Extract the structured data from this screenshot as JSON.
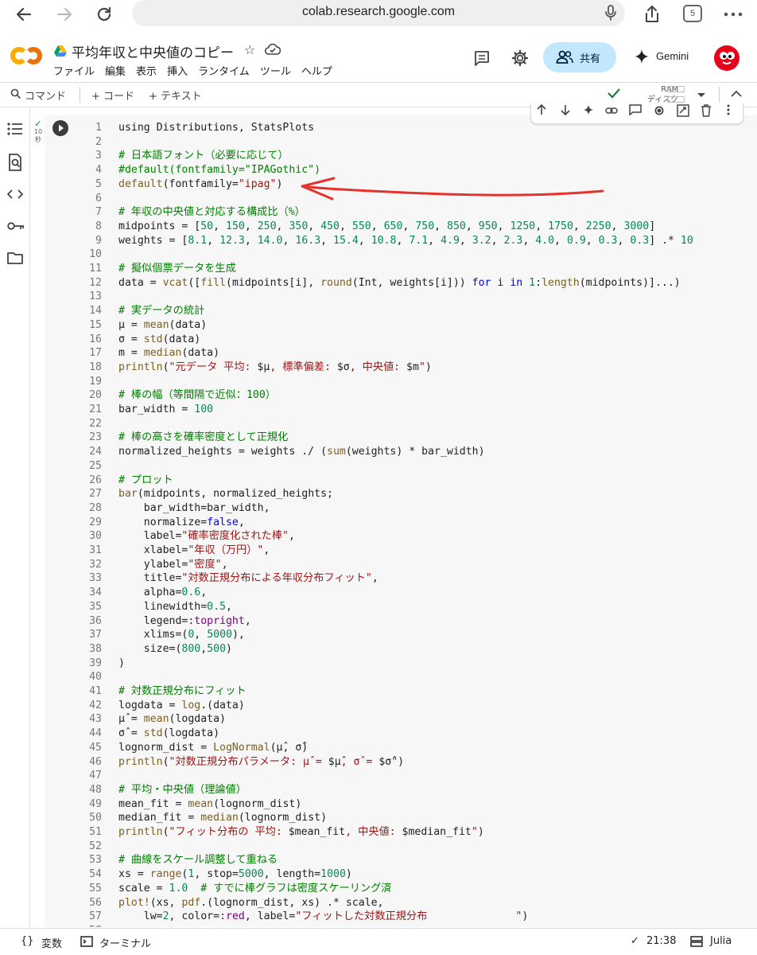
{
  "browser": {
    "url": "colab.research.google.com",
    "tab_count": "5"
  },
  "header": {
    "notebook_title": "平均年収と中央値のコピー",
    "share_label": "共有",
    "gemini_label": "Gemini",
    "menu": [
      "ファイル",
      "編集",
      "表示",
      "挿入",
      "ランタイム",
      "ツール",
      "ヘルプ"
    ]
  },
  "toolbar": {
    "command_label": "コマンド",
    "add_code_label": "+ コード",
    "add_text_label": "+ テキスト",
    "ram_label": "RAM",
    "disk_label": "ディスク"
  },
  "cell": {
    "exec_time": "10",
    "exec_unit": "秒",
    "lines": [
      {
        "n": "1",
        "html": "using Distributions, StatsPlots"
      },
      {
        "n": "2",
        "html": ""
      },
      {
        "n": "3",
        "html": "<span class='c'># 日本語フォント（必要に応じて）</span>"
      },
      {
        "n": "4",
        "html": "<span class='c'>#default(fontfamily=\"IPAGothic\")</span>"
      },
      {
        "n": "5",
        "html": "<span class='f'>default</span>(fontfamily=<span class='s'>\"ipag\"</span>)"
      },
      {
        "n": "6",
        "html": ""
      },
      {
        "n": "7",
        "html": "<span class='c'># 年収の中央値と対応する構成比（%）</span>"
      },
      {
        "n": "8",
        "html": "midpoints = [<span class='n'>50</span>, <span class='n'>150</span>, <span class='n'>250</span>, <span class='n'>350</span>, <span class='n'>450</span>, <span class='n'>550</span>, <span class='n'>650</span>, <span class='n'>750</span>, <span class='n'>850</span>, <span class='n'>950</span>, <span class='n'>1250</span>, <span class='n'>1750</span>, <span class='n'>2250</span>, <span class='n'>3000</span>]"
      },
      {
        "n": "9",
        "html": "weights = [<span class='n'>8.1</span>, <span class='n'>12.3</span>, <span class='n'>14.0</span>, <span class='n'>16.3</span>, <span class='n'>15.4</span>, <span class='n'>10.8</span>, <span class='n'>7.1</span>, <span class='n'>4.9</span>, <span class='n'>3.2</span>, <span class='n'>2.3</span>, <span class='n'>4.0</span>, <span class='n'>0.9</span>, <span class='n'>0.3</span>, <span class='n'>0.3</span>] .* <span class='n'>10</span>"
      },
      {
        "n": "10",
        "html": ""
      },
      {
        "n": "11",
        "html": "<span class='c'># 擬似個票データを生成</span>"
      },
      {
        "n": "12",
        "html": "data = <span class='f'>vcat</span>([<span class='f'>fill</span>(midpoints[i], <span class='f'>round</span>(Int, weights[i])) <span class='k'>for</span> i <span class='k'>in</span> <span class='n'>1</span>:<span class='f'>length</span>(midpoints)]...)"
      },
      {
        "n": "13",
        "html": ""
      },
      {
        "n": "14",
        "html": "<span class='c'># 実データの統計</span>"
      },
      {
        "n": "15",
        "html": "μ = <span class='f'>mean</span>(data)"
      },
      {
        "n": "16",
        "html": "σ = <span class='f'>std</span>(data)"
      },
      {
        "n": "17",
        "html": "m = <span class='f'>median</span>(data)"
      },
      {
        "n": "18",
        "html": "<span class='f'>println</span>(<span class='s'>\"元データ 平均: </span>$μ<span class='s'>, 標準偏差: </span>$σ<span class='s'>, 中央値: </span>$m<span class='s'>\"</span>)"
      },
      {
        "n": "19",
        "html": ""
      },
      {
        "n": "20",
        "html": "<span class='c'># 棒の幅（等間隔で近似：100）</span>"
      },
      {
        "n": "21",
        "html": "bar_width = <span class='n'>100</span>"
      },
      {
        "n": "22",
        "html": ""
      },
      {
        "n": "23",
        "html": "<span class='c'># 棒の高さを確率密度として正規化</span>"
      },
      {
        "n": "24",
        "html": "normalized_heights = weights ./ (<span class='f'>sum</span>(weights) * bar_width)"
      },
      {
        "n": "25",
        "html": ""
      },
      {
        "n": "26",
        "html": "<span class='c'># プロット</span>"
      },
      {
        "n": "27",
        "html": "<span class='f'>bar</span>(midpoints, normalized_heights;"
      },
      {
        "n": "28",
        "html": "    bar_width=bar_width,"
      },
      {
        "n": "29",
        "html": "    normalize=<span class='k'>false</span>,"
      },
      {
        "n": "30",
        "html": "    label=<span class='s'>\"確率密度化された棒\"</span>,"
      },
      {
        "n": "31",
        "html": "    xlabel=<span class='s'>\"年収（万円）\"</span>,"
      },
      {
        "n": "32",
        "html": "    ylabel=<span class='s'>\"密度\"</span>,"
      },
      {
        "n": "33",
        "html": "    title=<span class='s'>\"対数正規分布による年収分布フィット\"</span>,"
      },
      {
        "n": "34",
        "html": "    alpha=<span class='n'>0.6</span>,"
      },
      {
        "n": "35",
        "html": "    linewidth=<span class='n'>0.5</span>,"
      },
      {
        "n": "36",
        "html": "    legend=<span class='sym'>:topright</span>,"
      },
      {
        "n": "37",
        "html": "    xlims=(<span class='n'>0</span>, <span class='n'>5000</span>),"
      },
      {
        "n": "38",
        "html": "    size=(<span class='n'>800</span>,<span class='n'>500</span>)"
      },
      {
        "n": "39",
        "html": ")"
      },
      {
        "n": "40",
        "html": ""
      },
      {
        "n": "41",
        "html": "<span class='c'># 対数正規分布にフィット</span>"
      },
      {
        "n": "42",
        "html": "logdata = <span class='f'>log</span>.(data)"
      },
      {
        "n": "43",
        "html": "μ̂ = <span class='f'>mean</span>(logdata)"
      },
      {
        "n": "44",
        "html": "σ̂ = <span class='f'>std</span>(logdata)"
      },
      {
        "n": "45",
        "html": "lognorm_dist = <span class='f'>LogNormal</span>(μ̂, σ̂)"
      },
      {
        "n": "46",
        "html": "<span class='f'>println</span>(<span class='s'>\"対数正規分布パラメータ: μ̂ = </span>$μ̂<span class='s'>, σ̂ = </span>$σ̂<span class='s'>\"</span>)"
      },
      {
        "n": "47",
        "html": ""
      },
      {
        "n": "48",
        "html": "<span class='c'># 平均・中央値（理論値）</span>"
      },
      {
        "n": "49",
        "html": "mean_fit = <span class='f'>mean</span>(lognorm_dist)"
      },
      {
        "n": "50",
        "html": "median_fit = <span class='f'>median</span>(lognorm_dist)"
      },
      {
        "n": "51",
        "html": "<span class='f'>println</span>(<span class='s'>\"フィット分布の 平均: </span>$mean_fit<span class='s'>, 中央値: </span>$median_fit<span class='s'>\"</span>)"
      },
      {
        "n": "52",
        "html": ""
      },
      {
        "n": "53",
        "html": "<span class='c'># 曲線をスケール調整して重ねる</span>"
      },
      {
        "n": "54",
        "html": "xs = <span class='f'>range</span>(<span class='n'>1</span>, stop=<span class='n'>5000</span>, length=<span class='n'>1000</span>)"
      },
      {
        "n": "55",
        "html": "scale = <span class='n'>1.0</span>  <span class='c'># すでに棒グラフは密度スケーリング済</span>"
      },
      {
        "n": "56",
        "html": "<span class='f'>plot!</span>(xs, <span class='f'>pdf</span>.(lognorm_dist, xs) .* scale,"
      },
      {
        "n": "57",
        "html": "    lw=<span class='n'>2</span>, color=<span class='sym'>:red</span>, label=<span class='s'>\"フィットした対数正規分布              \"</span>)"
      },
      {
        "n": "58",
        "html": ""
      }
    ]
  },
  "statusbar": {
    "variables_label": "変数",
    "terminal_label": "ターミナル",
    "time": "21:38",
    "kernel": "Julia"
  }
}
